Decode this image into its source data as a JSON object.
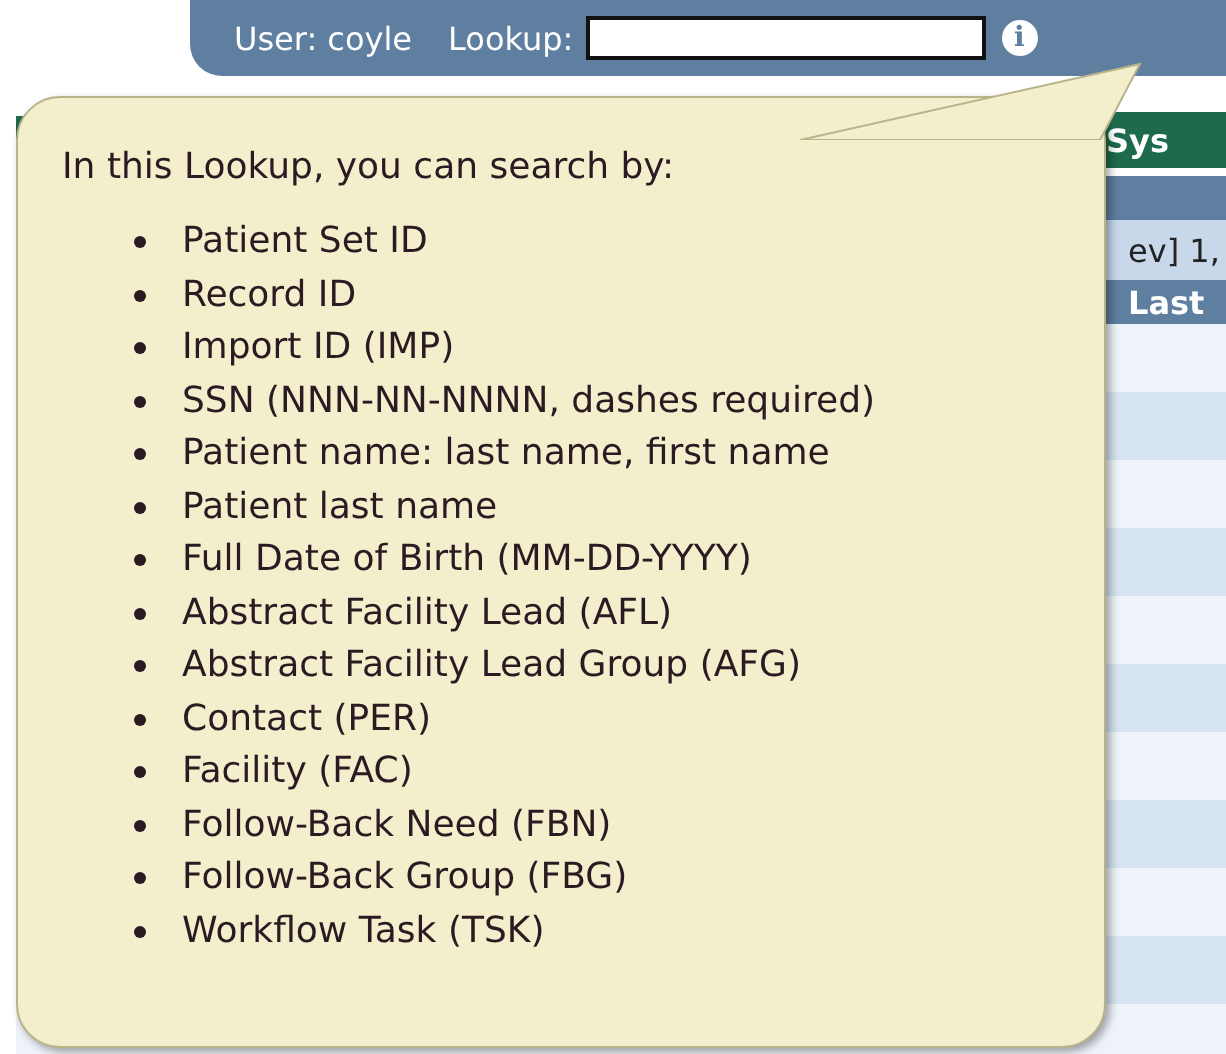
{
  "topbar": {
    "user_label": "User: coyle",
    "lookup_label": "Lookup:",
    "info_icon": "i"
  },
  "background": {
    "tab": "Sys",
    "pager": "ev] 1,",
    "column_heading": "Last"
  },
  "tooltip": {
    "intro": "In this Lookup, you can search by:",
    "items": [
      "Patient Set ID",
      "Record ID",
      "Import ID (IMP)",
      "SSN (NNN-NN-NNNN, dashes required)",
      "Patient name: last name, first name",
      "Patient last name",
      "Full Date of Birth (MM-DD-YYYY)",
      "Abstract Facility Lead (AFL)",
      "Abstract Facility Lead Group (AFG)",
      "Contact (PER)",
      "Facility (FAC)",
      "Follow-Back Need (FBN)",
      "Follow-Back Group (FBG)",
      "Workflow Task (TSK)"
    ]
  }
}
